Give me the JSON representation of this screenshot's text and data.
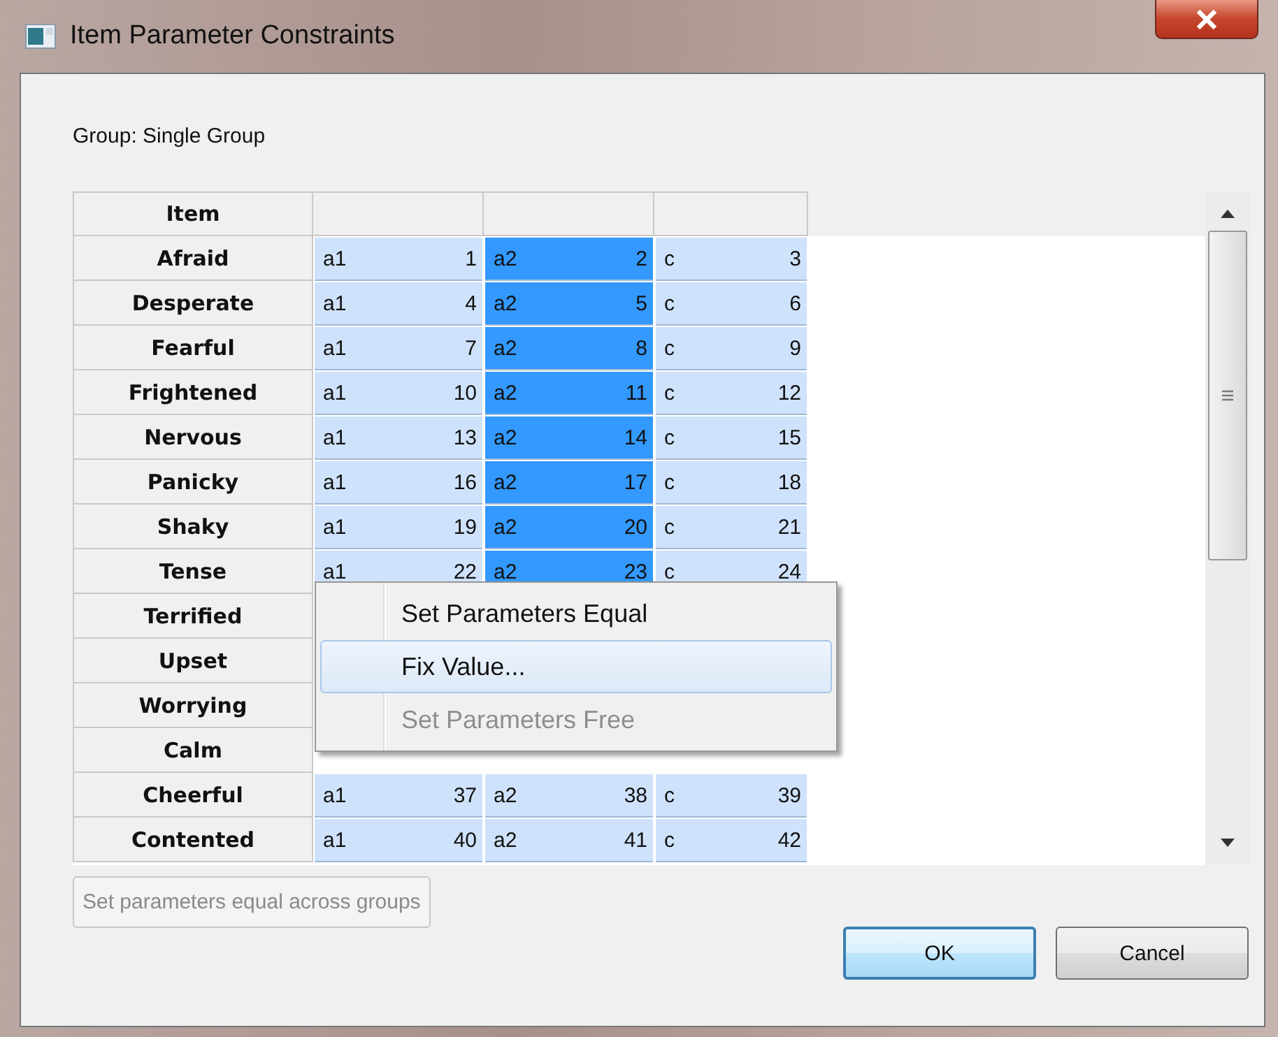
{
  "window": {
    "title": "Item Parameter Constraints"
  },
  "group_label": "Group: Single Group",
  "table": {
    "columns": [
      "Item",
      "",
      "",
      ""
    ],
    "rows": [
      {
        "item": "Afraid",
        "cells": [
          {
            "name": "a1",
            "value": "1",
            "selected": false
          },
          {
            "name": "a2",
            "value": "2",
            "selected": true
          },
          {
            "name": "c",
            "value": "3",
            "selected": false
          }
        ]
      },
      {
        "item": "Desperate",
        "cells": [
          {
            "name": "a1",
            "value": "4",
            "selected": false
          },
          {
            "name": "a2",
            "value": "5",
            "selected": true
          },
          {
            "name": "c",
            "value": "6",
            "selected": false
          }
        ]
      },
      {
        "item": "Fearful",
        "cells": [
          {
            "name": "a1",
            "value": "7",
            "selected": false
          },
          {
            "name": "a2",
            "value": "8",
            "selected": true
          },
          {
            "name": "c",
            "value": "9",
            "selected": false
          }
        ]
      },
      {
        "item": "Frightened",
        "cells": [
          {
            "name": "a1",
            "value": "10",
            "selected": false
          },
          {
            "name": "a2",
            "value": "11",
            "selected": true
          },
          {
            "name": "c",
            "value": "12",
            "selected": false
          }
        ]
      },
      {
        "item": "Nervous",
        "cells": [
          {
            "name": "a1",
            "value": "13",
            "selected": false
          },
          {
            "name": "a2",
            "value": "14",
            "selected": true
          },
          {
            "name": "c",
            "value": "15",
            "selected": false
          }
        ]
      },
      {
        "item": "Panicky",
        "cells": [
          {
            "name": "a1",
            "value": "16",
            "selected": false
          },
          {
            "name": "a2",
            "value": "17",
            "selected": true
          },
          {
            "name": "c",
            "value": "18",
            "selected": false
          }
        ]
      },
      {
        "item": "Shaky",
        "cells": [
          {
            "name": "a1",
            "value": "19",
            "selected": false
          },
          {
            "name": "a2",
            "value": "20",
            "selected": true
          },
          {
            "name": "c",
            "value": "21",
            "selected": false
          }
        ]
      },
      {
        "item": "Tense",
        "cells": [
          {
            "name": "a1",
            "value": "22",
            "selected": false
          },
          {
            "name": "a2",
            "value": "23",
            "selected": true
          },
          {
            "name": "c",
            "value": "24",
            "selected": false
          }
        ]
      },
      {
        "item": "Terrified"
      },
      {
        "item": "Upset"
      },
      {
        "item": "Worrying"
      },
      {
        "item": "Calm"
      },
      {
        "item": "Cheerful",
        "cells": [
          {
            "name": "a1",
            "value": "37",
            "selected": false
          },
          {
            "name": "a2",
            "value": "38",
            "selected": false
          },
          {
            "name": "c",
            "value": "39",
            "selected": false
          }
        ]
      },
      {
        "item": "Contented",
        "cells": [
          {
            "name": "a1",
            "value": "40",
            "selected": false
          },
          {
            "name": "a2",
            "value": "41",
            "selected": false
          },
          {
            "name": "c",
            "value": "42",
            "selected": false
          }
        ]
      }
    ]
  },
  "context_menu": {
    "items": [
      {
        "label": "Set Parameters Equal",
        "selected": false,
        "disabled": false
      },
      {
        "label": "Fix Value...",
        "selected": true,
        "disabled": false
      },
      {
        "label": "Set Parameters Free",
        "selected": false,
        "disabled": true
      }
    ]
  },
  "across_groups_button": {
    "label": "Set parameters equal across groups",
    "disabled": true
  },
  "buttons": [
    {
      "label": "OK",
      "kind": "default"
    },
    {
      "label": "Cancel",
      "kind": "normal"
    }
  ]
}
